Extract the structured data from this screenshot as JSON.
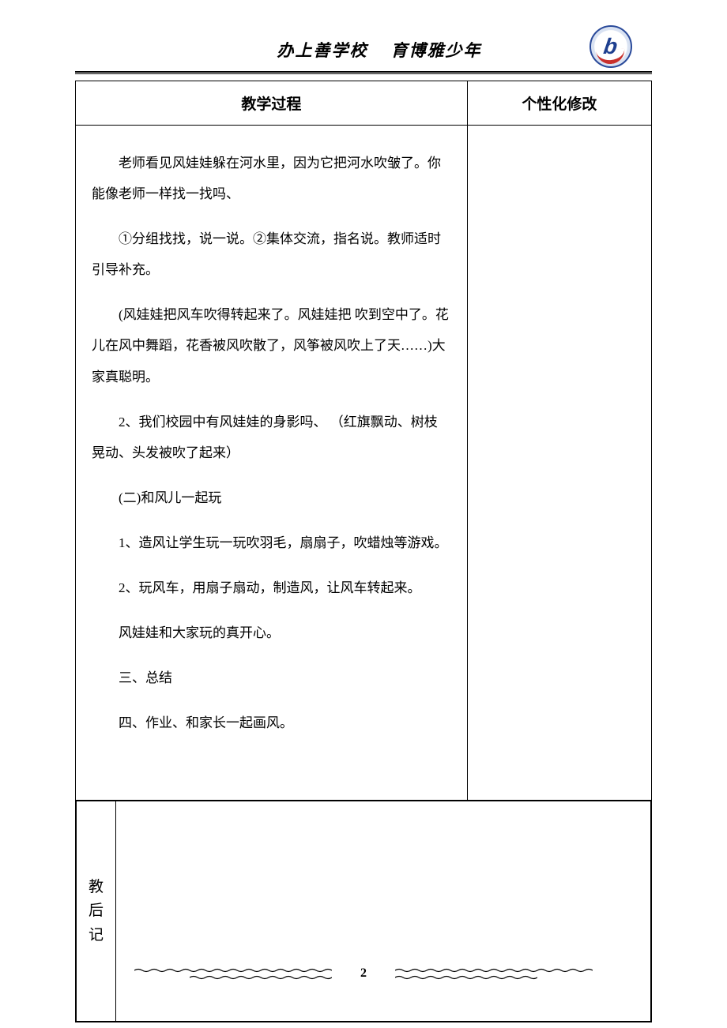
{
  "header": {
    "motto": "办上善学校    育博雅少年"
  },
  "table": {
    "header_process": "教学过程",
    "header_notes": "个性化修改",
    "p1a": "老师看见风娃娃躲在河水里，因为它把河水吹皱了。你",
    "p1b": "能像老师一样找一找吗、",
    "p2a": "①分组找找，说一说。②集体交流，指名说。教师适时",
    "p2b": "引导补充。",
    "p3a": "(风娃娃把风车吹得转起来了。风娃娃把 吹到空中了。花",
    "p3b": "儿在风中舞蹈，花香被风吹散了，风筝被风吹上了天……)大",
    "p3c": "家真聪明。",
    "p4a": "2、我们校园中有风娃娃的身影吗、  （红旗飘动、树枝",
    "p4b": "晃动、头发被吹了起来）",
    "p5": "(二)和风儿一起玩",
    "p6": "1、造风让学生玩一玩吹羽毛，扇扇子，吹蜡烛等游戏。",
    "p7": "2、玩风车，用扇子扇动，制造风，让风车转起来。",
    "p8": "风娃娃和大家玩的真开心。",
    "p9": "三、总结",
    "p10": "四、作业、和家长一起画风。"
  },
  "afternote_label_1": "教",
  "afternote_label_2": "后",
  "afternote_label_3": "记",
  "page_number": "2"
}
